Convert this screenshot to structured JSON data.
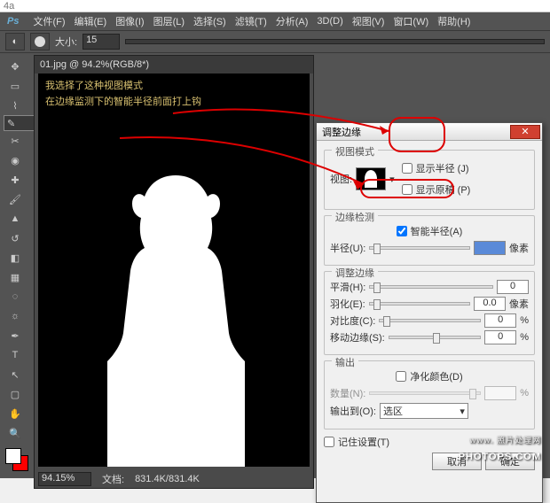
{
  "top_label": "4a",
  "menubar": {
    "logo": "Ps",
    "items": [
      "文件(F)",
      "编辑(E)",
      "图像(I)",
      "图层(L)",
      "选择(S)",
      "滤镜(T)",
      "分析(A)",
      "3D(D)",
      "视图(V)",
      "窗口(W)",
      "帮助(H)"
    ]
  },
  "optbar": {
    "size_label": "大小:",
    "size_value": "15"
  },
  "doc": {
    "tab": "01.jpg @ 94.2%(RGB/8*)",
    "annot1": "我选择了这种视图模式",
    "annot2": "在边缘监测下的智能半径前面打上钩"
  },
  "status": {
    "zoom": "94.15%",
    "file_label": "文档:",
    "file": "831.4K/831.4K"
  },
  "dialog": {
    "title": "调整边缘",
    "sec_view": "视图模式",
    "view_label": "视图:",
    "show_radius": "显示半径 (J)",
    "show_orig": "显示原稿 (P)",
    "sec_edge": "边缘检测",
    "smart_radius": "智能半径(A)",
    "radius_label": "半径(U):",
    "radius_val": "",
    "px": "像素",
    "sec_adjust": "调整边缘",
    "smooth": "平滑(H):",
    "smooth_val": "0",
    "feather": "羽化(E):",
    "feather_val": "0.0",
    "contrast": "对比度(C):",
    "contrast_val": "0",
    "shift": "移动边缘(S):",
    "shift_val": "0",
    "pct": "%",
    "sec_out": "输出",
    "decon": "净化颜色(D)",
    "amount": "数量(N):",
    "outto": "输出到(O):",
    "outsel": "选区",
    "remember": "记住设置(T)",
    "ok": "确定",
    "cancel": "取消"
  },
  "watermark": {
    "small": "www. 照片处理网",
    "big": "PHOTOPS.COM"
  }
}
